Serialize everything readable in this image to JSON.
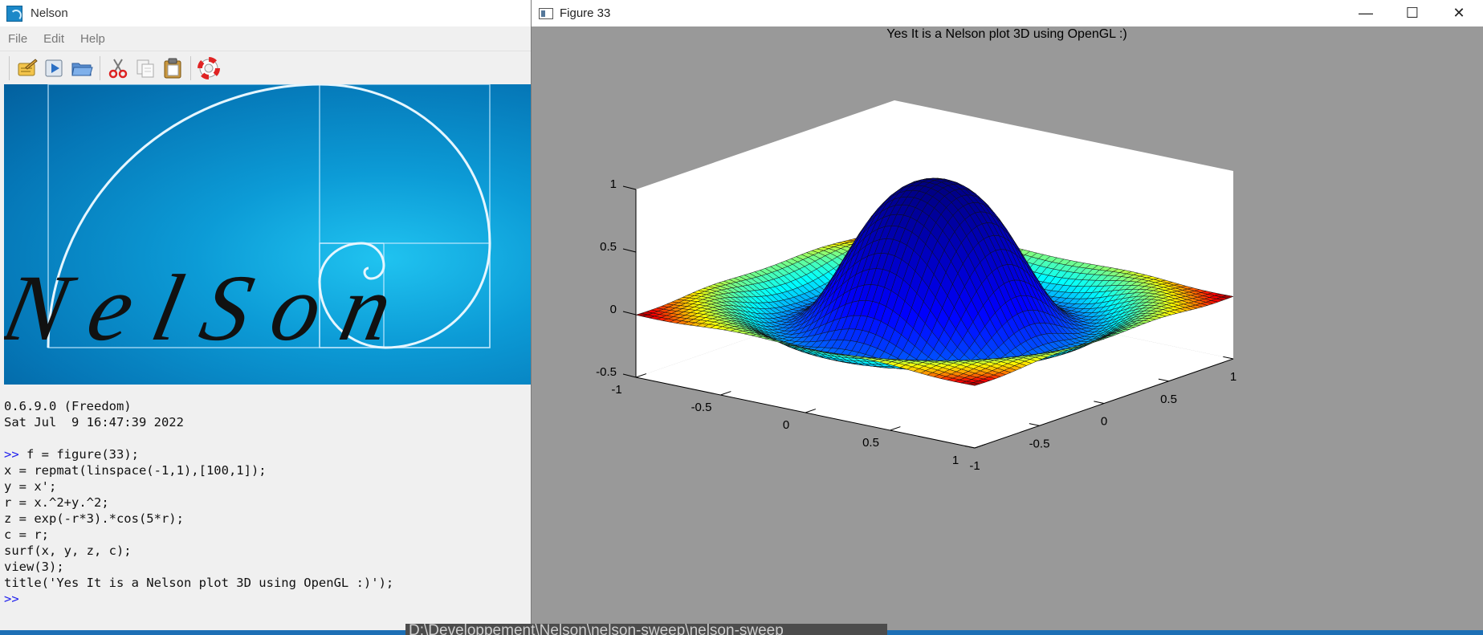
{
  "nelson_window": {
    "title": "Nelson",
    "menu": [
      "File",
      "Edit",
      "Help"
    ],
    "toolbar": [
      "edit-icon",
      "run-icon",
      "open-folder-icon",
      "cut-icon",
      "copy-icon",
      "paste-icon",
      "help-lifebuoy-icon"
    ],
    "banner_logo_text": "NelSon",
    "console_lines": [
      {
        "prompt": "",
        "text": "0.6.9.0 (Freedom)"
      },
      {
        "prompt": "",
        "text": "Sat Jul  9 16:47:39 2022"
      },
      {
        "prompt": "",
        "text": ""
      },
      {
        "prompt": ">> ",
        "text": "f = figure(33);"
      },
      {
        "prompt": "",
        "text": "x = repmat(linspace(-1,1),[100,1]);"
      },
      {
        "prompt": "",
        "text": "y = x';"
      },
      {
        "prompt": "",
        "text": "r = x.^2+y.^2;"
      },
      {
        "prompt": "",
        "text": "z = exp(-r*3).*cos(5*r);"
      },
      {
        "prompt": "",
        "text": "c = r;"
      },
      {
        "prompt": "",
        "text": "surf(x, y, z, c);"
      },
      {
        "prompt": "",
        "text": "view(3);"
      },
      {
        "prompt": "",
        "text": "title('Yes It is a Nelson plot 3D using OpenGL :)');"
      },
      {
        "prompt": ">>",
        "text": ""
      }
    ]
  },
  "figure_window": {
    "title": "Figure 33",
    "controls": {
      "minimize": "—",
      "maximize": "☐",
      "close": "✕"
    },
    "background_color": "#999999"
  },
  "taskbar": {
    "partial_text": "D:\\Developpement\\Nelson\\nelson-sweep\\nelson-sweep"
  },
  "chart_data": {
    "type": "surface",
    "title": "Yes It is a Nelson plot 3D using OpenGL :)",
    "function": "z = exp(-3*r) * cos(5*r), r = x^2 + y^2",
    "x_range": [
      -1,
      1
    ],
    "y_range": [
      -1,
      1
    ],
    "z_range": [
      -0.5,
      1
    ],
    "x_ticks": [
      "-1",
      "-0.5",
      "0",
      "0.5",
      "1"
    ],
    "y_ticks": [
      "-1",
      "-0.5",
      "0",
      "0.5",
      "1"
    ],
    "z_ticks": [
      "-0.5",
      "0",
      "0.5",
      "1"
    ],
    "grid_points": 100,
    "colormap": "jet",
    "axes_background": "#ffffff"
  }
}
